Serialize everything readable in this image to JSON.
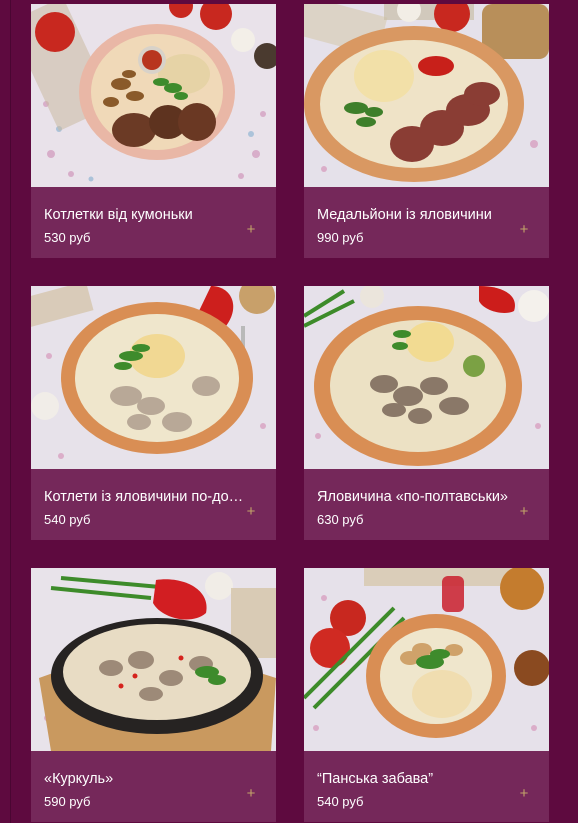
{
  "menu": {
    "items": [
      {
        "name": "Котлетки від кумоньки",
        "price": "530 руб",
        "add_icon": "+"
      },
      {
        "name": "Медальйони із яловичини",
        "price": "990 руб",
        "add_icon": "+"
      },
      {
        "name": "Котлети із яловичини по-домашньому",
        "price": "540 руб",
        "add_icon": "+"
      },
      {
        "name": "Яловичина «по-полтавськи»",
        "price": "630 руб",
        "add_icon": "+"
      },
      {
        "name": "«Куркуль»",
        "price": "590 руб",
        "add_icon": "+"
      },
      {
        "name": "“Панська забава”",
        "price": "540 руб",
        "add_icon": "+"
      }
    ]
  },
  "colors": {
    "background": "#5e0a3f",
    "card": "#75285a",
    "add_icon": "#c3a56a"
  }
}
